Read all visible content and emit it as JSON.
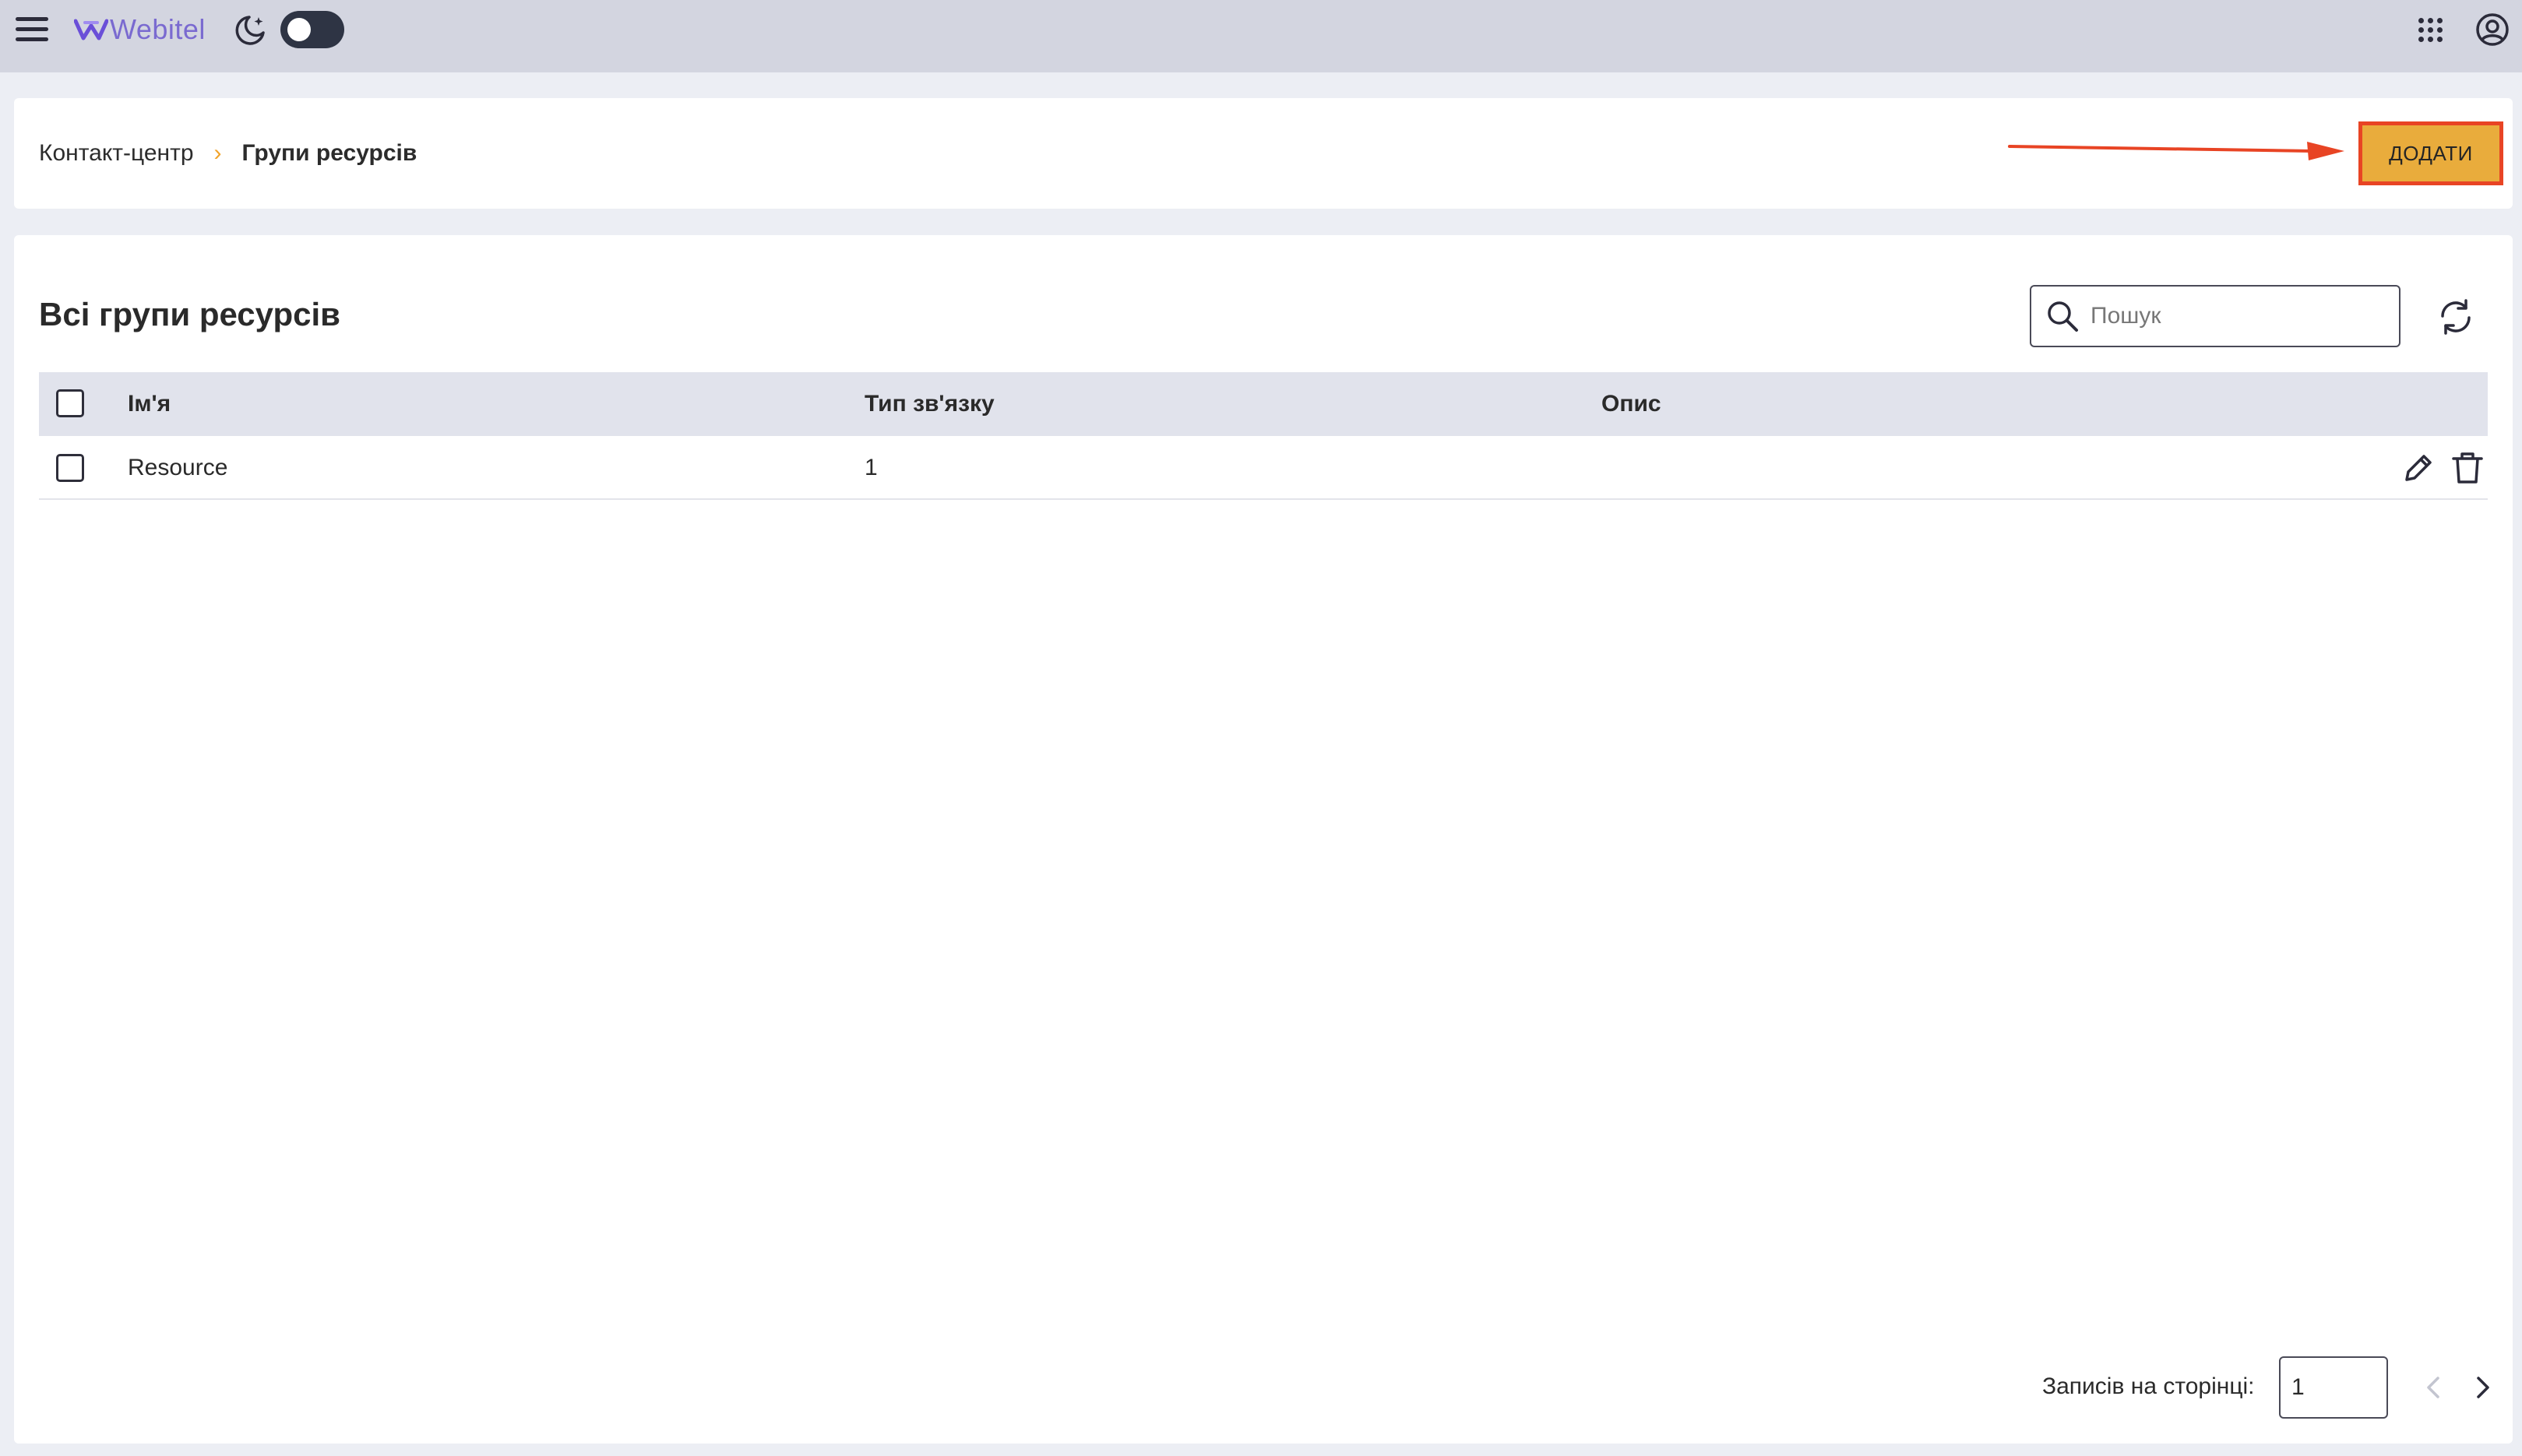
{
  "topbar": {
    "brand": "Webitel",
    "brand_color": "#7a6ad0",
    "icons": [
      "menu-icon",
      "moon-icon",
      "theme-toggle",
      "apps-grid-icon",
      "user-account-icon"
    ]
  },
  "breadcrumb": {
    "parent": "Контакт-центр",
    "separator": "›",
    "current": "Групи ресурсів"
  },
  "header": {
    "add_button_label": "ДОДАТИ",
    "add_button_color": "#e9ac3c",
    "highlight_color": "#e84424"
  },
  "main": {
    "title": "Всі групи ресурсів",
    "search": {
      "placeholder": "Пошук",
      "value": ""
    }
  },
  "table": {
    "columns": [
      "Ім'я",
      "Тип зв'язку",
      "Опис"
    ],
    "rows": [
      {
        "name": "Resource",
        "type": "1",
        "description": ""
      }
    ]
  },
  "pagination": {
    "per_page_label": "Записів на сторінці:",
    "per_page_value": "1"
  }
}
